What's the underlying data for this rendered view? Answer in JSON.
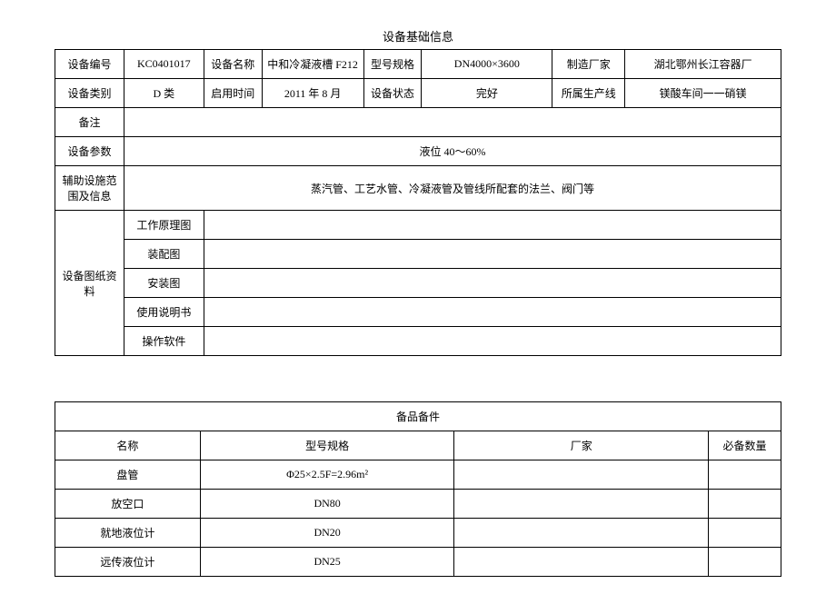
{
  "table1": {
    "title": "设备基础信息",
    "row1": {
      "c1": "设备编号",
      "c2": "KC0401017",
      "c3": "设备名称",
      "c4": "中和冷凝液槽 F212",
      "c5": "型号规格",
      "c6": "DN4000×3600",
      "c7": "制造厂家",
      "c8": "湖北鄂州长江容器厂"
    },
    "row2": {
      "c1": "设备类别",
      "c2": "D 类",
      "c3": "启用时间",
      "c4": "2011 年 8 月",
      "c5": "设备状态",
      "c6": "完好",
      "c7": "所属生产线",
      "c8": "镁酸车间一一硝镁"
    },
    "row3": {
      "c1": "备注",
      "c2": ""
    },
    "row4": {
      "c1": "设备参数",
      "c2": "液位 40～60%"
    },
    "row5": {
      "c1": "辅助设施范围及信息",
      "c2": "蒸汽管、工艺水管、冷凝液管及管线所配套的法兰、阀门等"
    },
    "row6": {
      "c1": "设备图纸资料",
      "sub": [
        {
          "label": "工作原理图",
          "val": ""
        },
        {
          "label": "装配图",
          "val": ""
        },
        {
          "label": "安装图",
          "val": ""
        },
        {
          "label": "使用说明书",
          "val": ""
        },
        {
          "label": "操作软件",
          "val": ""
        }
      ]
    }
  },
  "table2": {
    "title": "备品备件",
    "headers": {
      "h1": "名称",
      "h2": "型号规格",
      "h3": "厂家",
      "h4": "必备数量"
    },
    "rows": [
      {
        "c1": "盘管",
        "c2": "Φ25×2.5F=2.96m²",
        "c3": "",
        "c4": ""
      },
      {
        "c1": "放空口",
        "c2": "DN80",
        "c3": "",
        "c4": ""
      },
      {
        "c1": "就地液位计",
        "c2": "DN20",
        "c3": "",
        "c4": ""
      },
      {
        "c1": "远传液位计",
        "c2": "DN25",
        "c3": "",
        "c4": ""
      }
    ]
  }
}
